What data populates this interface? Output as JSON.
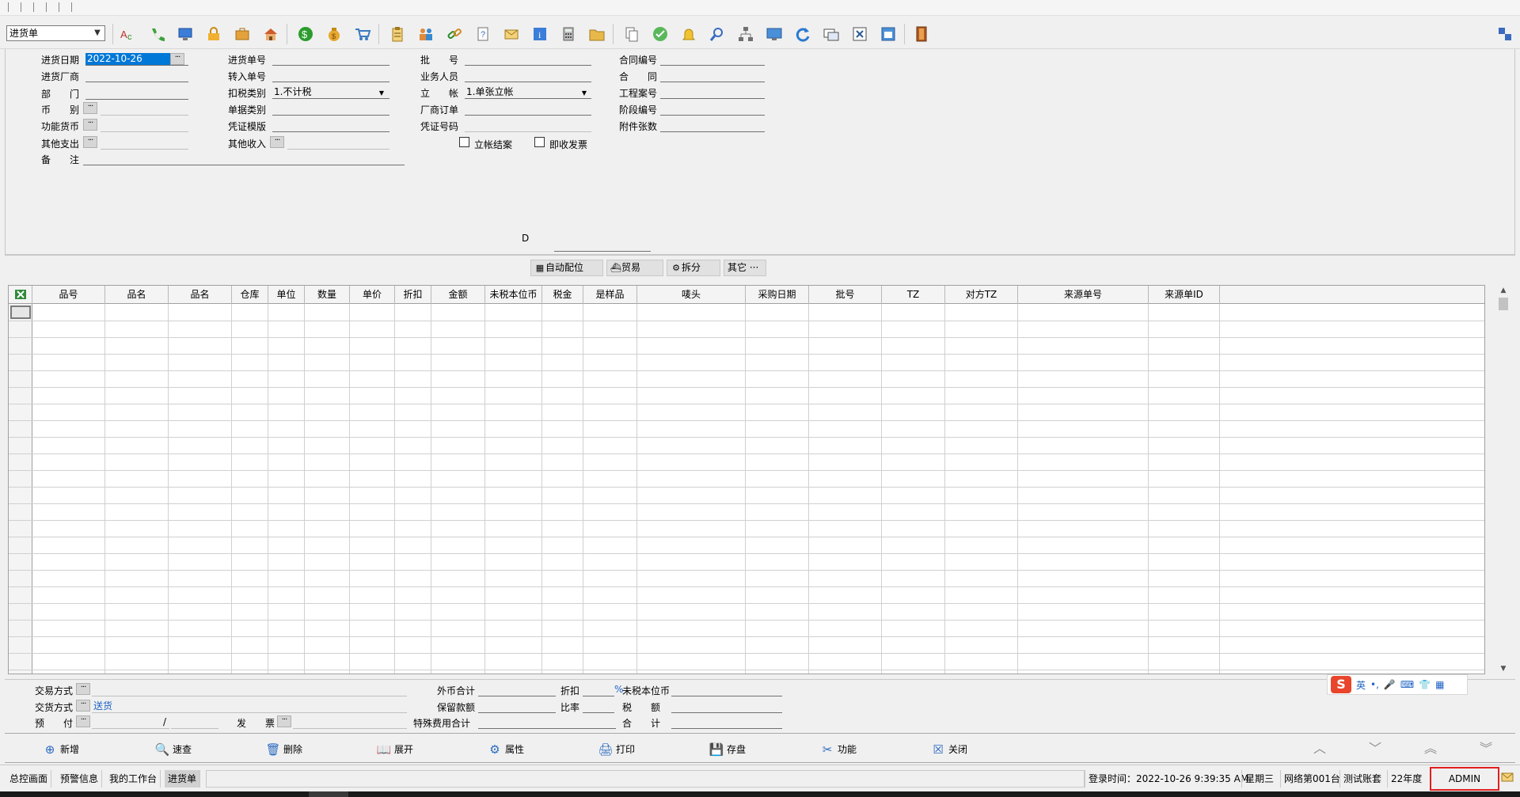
{
  "toolbar": {
    "doc_type": "进货单"
  },
  "form": {
    "col1": {
      "purchase_date_label": "进货日期",
      "purchase_date_value": "2022-10-26",
      "vendor_label": "进货厂商",
      "dept_label": "部　　门",
      "currency_label": "币　　别",
      "func_currency_label": "功能货币",
      "other_expense_label": "其他支出",
      "remark_label": "备　　注"
    },
    "col2": {
      "purchase_no_label": "进货单号",
      "import_no_label": "转入单号",
      "tax_type_label": "扣税类别",
      "tax_type_value": "1.不计税",
      "doc_category_label": "单据类别",
      "voucher_template_label": "凭证模版",
      "other_income_label": "其他收入"
    },
    "col3": {
      "batch_no_label": "批　　号",
      "salesperson_label": "业务人员",
      "account_label": "立　　帐",
      "account_value": "1.单张立帐",
      "vendor_order_label": "厂商订单",
      "voucher_no_label": "凭证号码",
      "close_account_label": "立帐结案",
      "invoice_now_label": "即收发票"
    },
    "col4": {
      "contract_no_label": "合同编号",
      "contract_label": "合　　同",
      "project_no_label": "工程案号",
      "stage_no_label": "阶段编号",
      "attachments_label": "附件张数"
    },
    "d_label": "D"
  },
  "midbar": {
    "auto_alloc": "自动配位",
    "trade": "贸易",
    "split": "拆分",
    "other": "其它 ···"
  },
  "grid": {
    "columns": [
      "品号",
      "品名",
      "品名",
      "仓库",
      "单位",
      "数量",
      "单价",
      "折扣",
      "金额",
      "未税本位币",
      "税金",
      "是样品",
      "唛头",
      "采购日期",
      "批号",
      "TZ",
      "对方TZ",
      "来源单号",
      "来源单ID"
    ]
  },
  "summary": {
    "trade_method_label": "交易方式",
    "delivery_method_label": "交货方式",
    "delivery_method_value": "送货",
    "prepay_label": "预　　付",
    "slash": "/",
    "invoice_label": "发　　票",
    "foreign_total_label": "外币合计",
    "retention_label": "保留款额",
    "special_fee_label": "特殊费用合计",
    "discount_label": "折扣",
    "rate_label": "比率",
    "percent": "%",
    "untaxed_local_label": "未税本位币",
    "tax_amount_label": "税　　额",
    "total_label": "合　　计",
    "ime_lang": "英",
    "ime_punct": "•,"
  },
  "actions": {
    "new": "新增",
    "search": "速查",
    "delete": "删除",
    "expand": "展开",
    "properties": "属性",
    "print": "打印",
    "save": "存盘",
    "functions": "功能",
    "close": "关闭"
  },
  "statusbar": {
    "tabs": [
      "总控画面",
      "预警信息",
      "我的工作台",
      "进货单"
    ],
    "login_time": "登录时间：2022-10-26 9:39:35 AM",
    "weekday": "星期三",
    "network": "网络第001台",
    "account_set": "测试账套",
    "fiscal_year": "22年度",
    "user": "ADMIN"
  },
  "colors": {
    "selection": "#0078d7",
    "highlight_box": "#e02020",
    "link": "#1f63c4"
  }
}
